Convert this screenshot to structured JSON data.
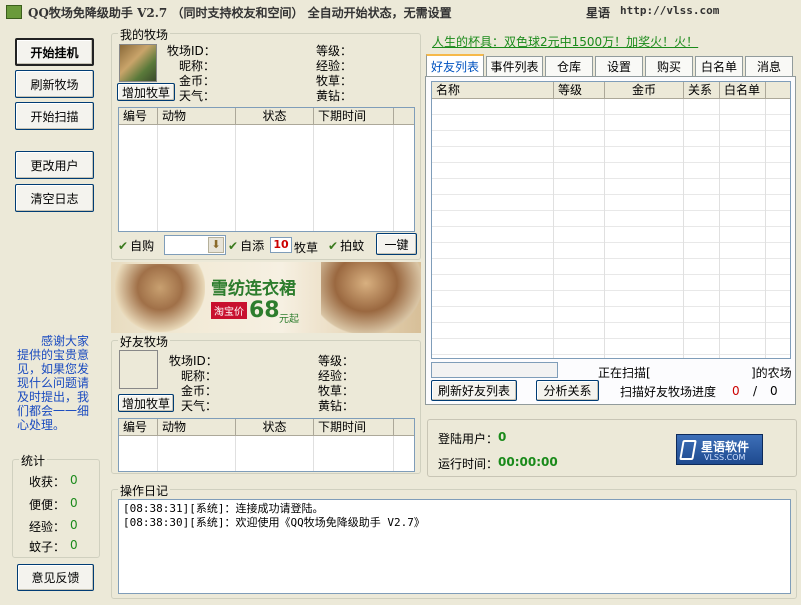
{
  "titlebar": {
    "title": "QQ牧场免降级助手 V2.7 （同时支持校友和空间） 全自动开始状态，无需设置",
    "brand": "星语",
    "url": "http://vlss.com"
  },
  "left_buttons": {
    "start_hang": "开始挂机",
    "refresh_farm": "刷新牧场",
    "start_scan": "开始扫描",
    "change_user": "更改用户",
    "clear_log": "清空日志",
    "feedback": "意见反馈"
  },
  "thanks_text": "感谢大家提供的宝贵意见，如果您发现什么问题请及时提出，我们都会一一细心处理。",
  "stats": {
    "legend": "统计",
    "items": [
      {
        "label": "收获：",
        "value": "0"
      },
      {
        "label": "便便：",
        "value": "0"
      },
      {
        "label": "经验：",
        "value": "0"
      },
      {
        "label": "蚊子：",
        "value": "0"
      }
    ]
  },
  "my_farm": {
    "legend": "我的牧场",
    "add_grass": "增加牧草",
    "fields_left": [
      "牧场ID：",
      "昵称：",
      "金币：",
      "天气："
    ],
    "fields_right": [
      "等级：",
      "经验：",
      "牧草：",
      "黄钻："
    ],
    "columns": [
      "编号",
      "动物",
      "状态",
      "下期时间"
    ],
    "auto_buy": "自购",
    "auto_add": "自添",
    "grass_count": "10",
    "grass_unit": "牧草",
    "catch_mosquito": "拍蚊",
    "one_key": "一键"
  },
  "ad_banner": {
    "headline": "雪纺连衣裙",
    "tag": "淘宝价",
    "price": "68",
    "price_unit": "元起"
  },
  "friend_farm": {
    "legend": "好友牧场",
    "add_grass": "增加牧草",
    "fields_left": [
      "牧场ID：",
      "昵称：",
      "金币：",
      "天气："
    ],
    "fields_right": [
      "等级：",
      "经验：",
      "牧草：",
      "黄钻："
    ],
    "columns": [
      "编号",
      "动物",
      "状态",
      "下期时间"
    ]
  },
  "marquee": "人生的杯具：双色球2元中1500万！加奖火！火！",
  "tabs": [
    "好友列表",
    "事件列表",
    "仓库",
    "设置",
    "购买",
    "白名单",
    "消息"
  ],
  "friend_list": {
    "columns": [
      "名称",
      "等级",
      "金币",
      "关系",
      "白名单"
    ],
    "scanning_prefix": "正在扫描[",
    "scanning_suffix": "]的农场",
    "refresh_btn": "刷新好友列表",
    "analyze_btn": "分析关系",
    "progress_label": "扫描好友牧场进度",
    "progress_current": "0",
    "progress_sep": "/",
    "progress_total": "0"
  },
  "login": {
    "user_label": "登陆用户：",
    "user_value": "0",
    "time_label": "运行时间：",
    "time_value": "00:00:00",
    "logo_text": "星语软件",
    "logo_sub": "VLSS.COM"
  },
  "log": {
    "legend": "操作日记",
    "lines": [
      "[08:38:31][系统]：连接成功请登陆。",
      "[08:38:30][系统]：欢迎使用《QQ牧场免降级助手 V2.7》"
    ]
  },
  "colors": {
    "accent_green": "#1a8a1a",
    "accent_red": "#cc0000",
    "tab_blue": "#0053c0"
  }
}
